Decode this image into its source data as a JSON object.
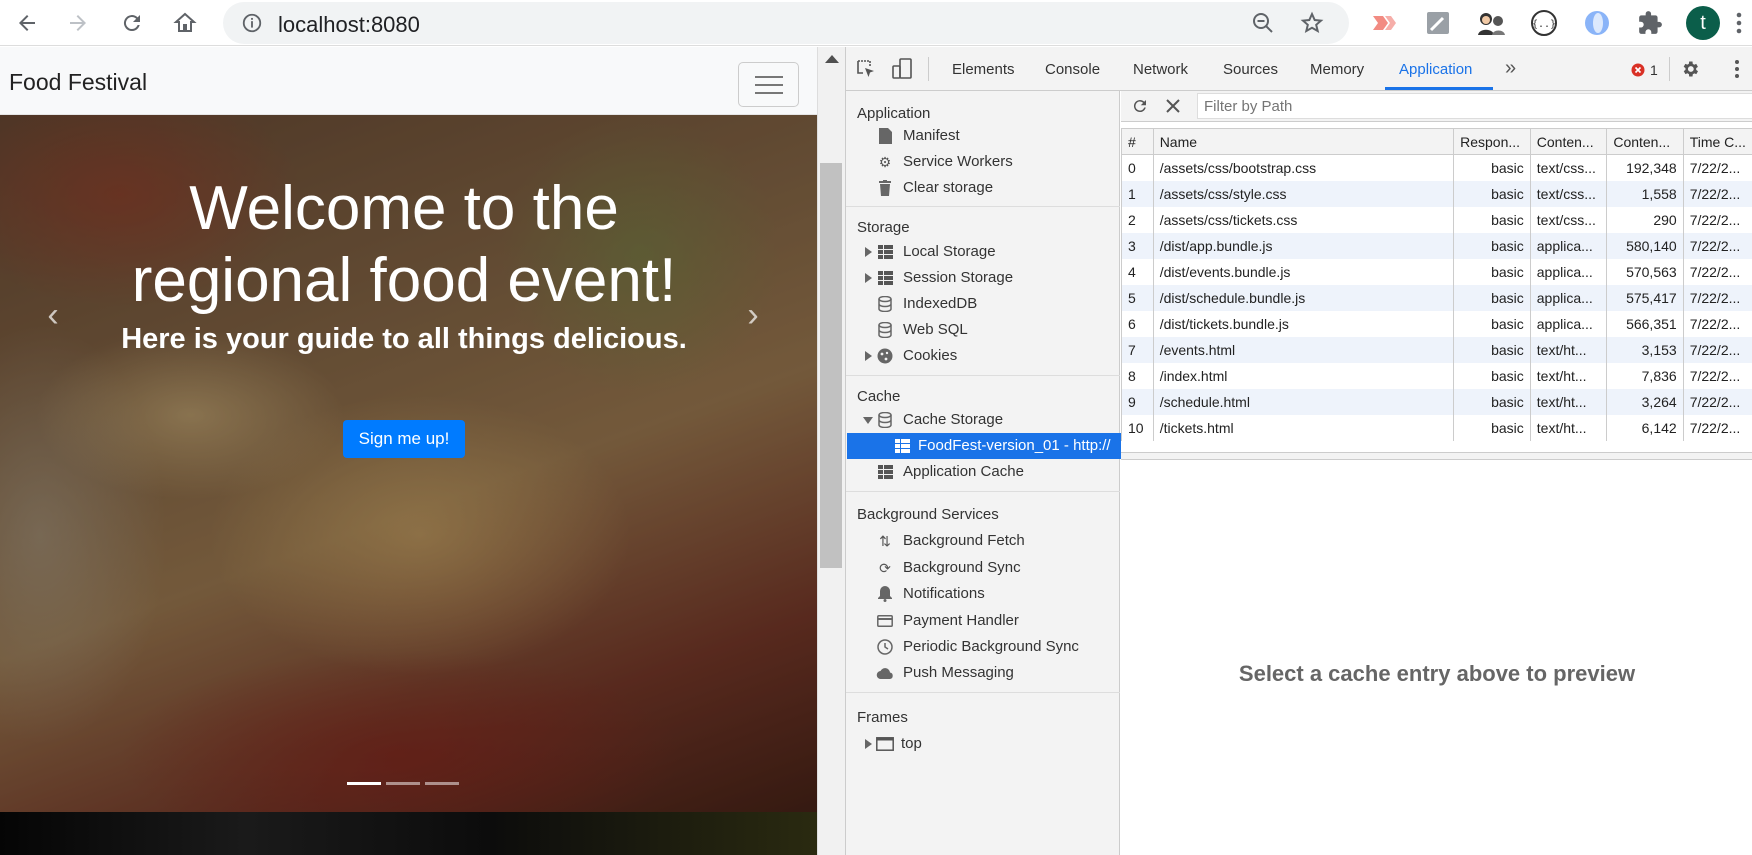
{
  "browser": {
    "url": "localhost:8080",
    "profile_initial": "t",
    "error_count": "1"
  },
  "site": {
    "brand": "Food Festival",
    "hero_title_line1": "Welcome to the",
    "hero_title_line2": "regional food event!",
    "hero_subtitle": "Here is your guide to all things delicious.",
    "cta": "Sign me up!",
    "prev_arrow": "‹",
    "next_arrow": "›"
  },
  "devtools": {
    "tabs": [
      "Elements",
      "Console",
      "Network",
      "Sources",
      "Memory",
      "Application"
    ],
    "more_tabs": "»",
    "active_tab": "Application",
    "sidebar": {
      "application_header": "Application",
      "application_items": [
        "Manifest",
        "Service Workers",
        "Clear storage"
      ],
      "storage_header": "Storage",
      "storage_items": [
        "Local Storage",
        "Session Storage",
        "IndexedDB",
        "Web SQL",
        "Cookies"
      ],
      "cache_header": "Cache",
      "cache_items": [
        "Cache Storage",
        "FoodFest-version_01 - http://",
        "Application Cache"
      ],
      "background_header": "Background Services",
      "background_items": [
        "Background Fetch",
        "Background Sync",
        "Notifications",
        "Payment Handler",
        "Periodic Background Sync",
        "Push Messaging"
      ],
      "frames_header": "Frames",
      "frames_items": [
        "top"
      ]
    },
    "filter_placeholder": "Filter by Path",
    "table": {
      "headers": [
        "#",
        "Name",
        "Respon...",
        "Conten...",
        "Conten...",
        "Time C..."
      ],
      "rows": [
        [
          "0",
          "/assets/css/bootstrap.css",
          "basic",
          "text/css...",
          "192,348",
          "7/22/2..."
        ],
        [
          "1",
          "/assets/css/style.css",
          "basic",
          "text/css...",
          "1,558",
          "7/22/2..."
        ],
        [
          "2",
          "/assets/css/tickets.css",
          "basic",
          "text/css...",
          "290",
          "7/22/2..."
        ],
        [
          "3",
          "/dist/app.bundle.js",
          "basic",
          "applica...",
          "580,140",
          "7/22/2..."
        ],
        [
          "4",
          "/dist/events.bundle.js",
          "basic",
          "applica...",
          "570,563",
          "7/22/2..."
        ],
        [
          "5",
          "/dist/schedule.bundle.js",
          "basic",
          "applica...",
          "575,417",
          "7/22/2..."
        ],
        [
          "6",
          "/dist/tickets.bundle.js",
          "basic",
          "applica...",
          "566,351",
          "7/22/2..."
        ],
        [
          "7",
          "/events.html",
          "basic",
          "text/ht...",
          "3,153",
          "7/22/2..."
        ],
        [
          "8",
          "/index.html",
          "basic",
          "text/ht...",
          "7,836",
          "7/22/2..."
        ],
        [
          "9",
          "/schedule.html",
          "basic",
          "text/ht...",
          "3,264",
          "7/22/2..."
        ],
        [
          "10",
          "/tickets.html",
          "basic",
          "text/ht...",
          "6,142",
          "7/22/2..."
        ]
      ]
    },
    "preview_text": "Select a cache entry above to preview"
  }
}
